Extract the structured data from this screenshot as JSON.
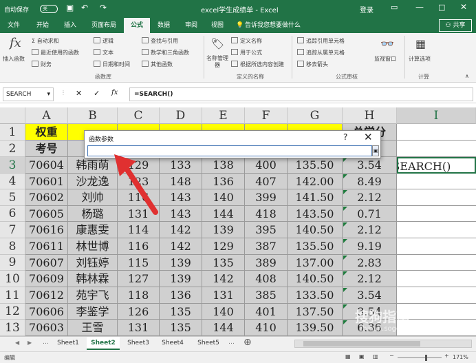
{
  "titlebar": {
    "autosave": "自动保存",
    "toggle": "关",
    "title": "excel学生成绩单 - Excel",
    "login": "登录"
  },
  "tabs": [
    "文件",
    "开始",
    "插入",
    "页面布局",
    "公式",
    "数据",
    "审阅",
    "视图"
  ],
  "tell_me": "告诉我您想要做什么",
  "share": "共享",
  "ribbon": {
    "insert_fn": "插入函数",
    "autosum": "自动求和",
    "recent": "最近使用的函数",
    "finance": "财务",
    "logic": "逻辑",
    "text": "文本",
    "datetime": "日期和时间",
    "lookup": "查找与引用",
    "math": "数学和三角函数",
    "other": "其他函数",
    "group_lib": "函数库",
    "name_mgr": "名称管理器",
    "define_name": "定义名称",
    "use_formula": "用于公式",
    "create_sel": "根据所选内容创建",
    "group_names": "定义的名称",
    "trace_prec": "追踪引用单元格",
    "trace_dep": "追踪从属单元格",
    "remove_arrows": "移去箭头",
    "group_audit": "公式审核",
    "watch": "监视窗口",
    "calc_opts": "计算选项",
    "group_calc": "计算"
  },
  "formula_bar": {
    "namebox": "SEARCH",
    "fx": "fx",
    "formula": "=SEARCH()"
  },
  "columns": [
    "A",
    "B",
    "C",
    "D",
    "E",
    "F",
    "G",
    "H",
    "I"
  ],
  "rows": [
    "1",
    "2",
    "3",
    "4",
    "5",
    "6",
    "7",
    "8",
    "9",
    "10",
    "11",
    "12",
    "13"
  ],
  "row1": {
    "A": "权重",
    "H": "总学分"
  },
  "row2": {
    "A": "考号",
    "H": "绩点"
  },
  "data_rows": [
    [
      "70604",
      "韩雨萌",
      "129",
      "133",
      "138",
      "400",
      "135.50",
      "3.54"
    ],
    [
      "70601",
      "沙龙逸",
      "123",
      "148",
      "136",
      "407",
      "142.00",
      "8.49"
    ],
    [
      "70602",
      "刘帅",
      "116",
      "143",
      "140",
      "399",
      "141.50",
      "2.12"
    ],
    [
      "70605",
      "杨璐",
      "131",
      "143",
      "144",
      "418",
      "143.50",
      "0.71"
    ],
    [
      "70616",
      "康惠雯",
      "114",
      "142",
      "139",
      "395",
      "140.50",
      "2.12"
    ],
    [
      "70611",
      "林世博",
      "116",
      "142",
      "129",
      "387",
      "135.50",
      "9.19"
    ],
    [
      "70607",
      "刘钰婷",
      "115",
      "139",
      "135",
      "389",
      "137.00",
      "2.83"
    ],
    [
      "70609",
      "韩林霖",
      "127",
      "139",
      "142",
      "408",
      "140.50",
      "2.12"
    ],
    [
      "70612",
      "苑宇飞",
      "118",
      "136",
      "131",
      "385",
      "133.50",
      "3.54"
    ],
    [
      "70606",
      "李鉴学",
      "126",
      "135",
      "140",
      "401",
      "137.50",
      "3.54"
    ],
    [
      "70603",
      "王雪",
      "131",
      "135",
      "144",
      "410",
      "139.50",
      "6.36"
    ]
  ],
  "i3_value": "=SEARCH()",
  "dialog": {
    "title": "函数参数",
    "help": "?",
    "close": "✕"
  },
  "sheets": [
    "Sheet1",
    "Sheet2",
    "Sheet3",
    "Sheet4",
    "Sheet5"
  ],
  "status": {
    "mode": "编辑",
    "zoom": "171%"
  },
  "watermark": {
    "brand": "搜狗指南",
    "url": "zhinan.sogou.com"
  },
  "colors": {
    "excel_green": "#217346",
    "yellow": "#ffff00",
    "arrow": "#e03030"
  }
}
